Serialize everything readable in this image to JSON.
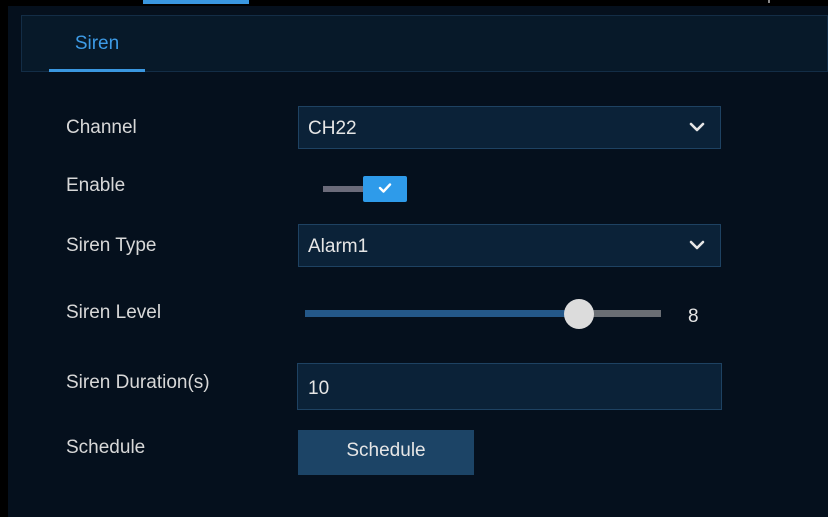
{
  "tabs": [
    {
      "label": "Siren",
      "active": true
    }
  ],
  "form": {
    "channel": {
      "label": "Channel",
      "value": "CH22"
    },
    "enable": {
      "label": "Enable",
      "checked": true
    },
    "siren_type": {
      "label": "Siren Type",
      "value": "Alarm1"
    },
    "siren_level": {
      "label": "Siren Level",
      "value": "8",
      "fraction": 0.77
    },
    "siren_duration": {
      "label": "Siren Duration(s)",
      "value": "10"
    },
    "schedule": {
      "label": "Schedule",
      "button_label": "Schedule"
    }
  },
  "icons": {
    "dropdown": "chevron-down-icon",
    "toggle_check": "check-icon"
  },
  "colors": {
    "accent": "#3a97e0",
    "panel": "#05101d",
    "field": "#0b2238",
    "button": "#1c4466",
    "text": "#d8d8d8"
  }
}
